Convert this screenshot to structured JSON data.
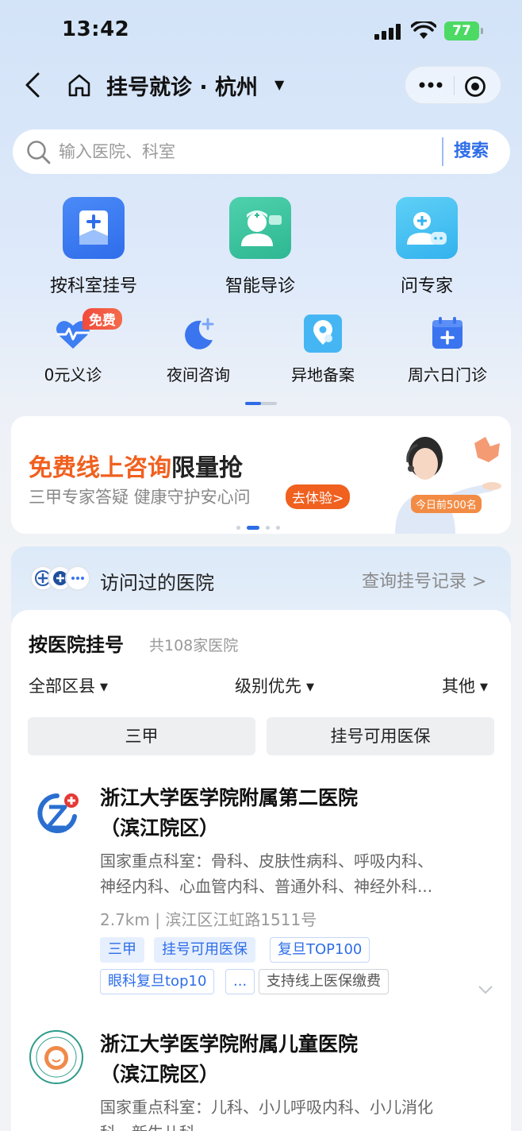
{
  "status_bar": {
    "time": "13:42",
    "battery": "77"
  },
  "nav": {
    "title": "挂号就诊 · 杭州"
  },
  "search": {
    "placeholder": "输入医院、科室",
    "button": "搜索"
  },
  "quick_entries": [
    {
      "label": "按科室挂号",
      "icon": "clipboard-plus-icon",
      "color": "#3d7cf3"
    },
    {
      "label": "智能导诊",
      "icon": "nurse-icon",
      "color": "#36c3a0"
    },
    {
      "label": "问专家",
      "icon": "doctor-chat-icon",
      "color": "#3cb8f2"
    }
  ],
  "secondary_entries": [
    {
      "label": "0元义诊",
      "icon": "heart-pulse-icon",
      "badge": "免费"
    },
    {
      "label": "夜间咨询",
      "icon": "moon-plus-icon"
    },
    {
      "label": "异地备案",
      "icon": "location-pin-icon"
    },
    {
      "label": "周六日门诊",
      "icon": "calendar-plus-icon"
    }
  ],
  "banner": {
    "title_highlight": "免费线上咨询",
    "title_rest": "限量抢",
    "subtitle": "三甲专家答疑 健康守护安心问",
    "button": "去体验>",
    "tag": "今日前500名"
  },
  "visited": {
    "title": "访问过的医院",
    "link": "查询挂号记录 >"
  },
  "hospitals_section": {
    "title": "按医院挂号",
    "count": "共108家医院",
    "filters": [
      "全部区县",
      "级别优先",
      "其他"
    ],
    "chips": [
      "三甲",
      "挂号可用医保"
    ]
  },
  "hospitals": [
    {
      "name_line1": "浙江大学医学院附属第二医院",
      "name_line2": "（滨江院区）",
      "desc_line1": "国家重点科室：骨科、皮肤性病科、呼吸内科、",
      "desc_line2": "神经内科、心血管内科、普通外科、神经外科...",
      "meta": "2.7km | 滨江区江虹路1511号",
      "tags": [
        "三甲",
        "挂号可用医保",
        "复旦TOP100",
        "眼科复旦top10",
        "...",
        "支持线上医保缴费"
      ]
    },
    {
      "name_line1": "浙江大学医学院附属儿童医院",
      "name_line2": "（滨江院区）",
      "desc_line1": "国家重点科室：儿科、小儿呼吸内科、小儿消化",
      "desc_line2": "科、新生儿科"
    }
  ],
  "colors": {
    "accent": "#2d6de8",
    "promo": "#f0601f"
  }
}
